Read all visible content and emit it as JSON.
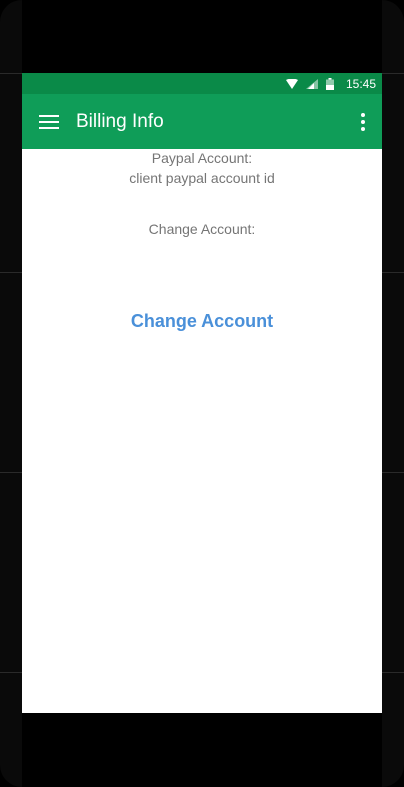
{
  "status_bar": {
    "time": "15:45",
    "icons": [
      "wifi-icon",
      "signal-icon",
      "battery-icon"
    ]
  },
  "app_bar": {
    "title": "Billing Info",
    "menu_icon": "hamburger-menu-icon",
    "overflow_icon": "more-vert-icon"
  },
  "content": {
    "paypal_label": "Paypal Account:",
    "paypal_value": "client paypal account id",
    "change_label": "Change Account:",
    "change_button": "Change Account"
  },
  "colors": {
    "status_bar": "#0a8a48",
    "app_bar": "#0f9d58",
    "text_secondary": "#757575",
    "button_text": "#4a90d9"
  }
}
